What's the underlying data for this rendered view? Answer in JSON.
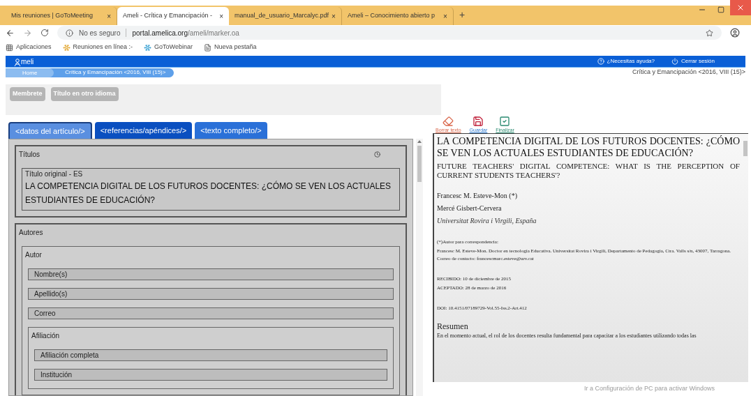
{
  "browser": {
    "tabs": [
      {
        "title": "Mis reuniones | GoToMeeting",
        "selected": false,
        "close": "×"
      },
      {
        "title": "Ameli - Crítica y Emancipación -",
        "selected": true,
        "close": "×"
      },
      {
        "title": "manual_de_usuario_Marcalyc.pdf",
        "selected": false,
        "close": "×"
      },
      {
        "title": "Ameli – Conocimiento abierto p",
        "selected": false,
        "close": "×"
      }
    ],
    "new_tab": "+",
    "security": "No es seguro",
    "url_host": "portal.amelica.org",
    "url_path": "/ameli/marker.oa",
    "bookmarks": [
      "Aplicaciones",
      "Reuniones en línea :-",
      "GoToWebinar",
      "Nueva pestaña"
    ]
  },
  "app": {
    "logo": "meli",
    "help": "¿Necesitas ayuda?",
    "logout": "Cerrar sesión",
    "breadcrumb": [
      "Home",
      "Crítica y Emancipación <2016, VIII (15)>"
    ],
    "issue": "Crítica y Emancipación <2016, VIII (15)>",
    "tool_buttons": [
      "Membrete",
      "Título en otro idioma"
    ],
    "tabs": [
      {
        "label": "<datos del artículo/>",
        "selected": true
      },
      {
        "label": "<referencias/apéndices/>",
        "selected": false
      },
      {
        "label": "<texto completo/>",
        "selected": false
      }
    ],
    "sections": [
      {
        "title": "Títulos",
        "children": [
          {
            "kind": "text",
            "label": "Título original - ES",
            "value": "LA COMPETENCIA DIGITAL DE LOS FUTUROS DOCENTES: ¿CÓMO SE VEN LOS ACTUALES ESTUDIANTES DE EDUCACIÓN?"
          }
        ]
      },
      {
        "title": "Autores",
        "children": [
          {
            "kind": "group",
            "title": "Autor",
            "children": [
              {
                "kind": "field",
                "label": "Nombre(s)"
              },
              {
                "kind": "field",
                "label": "Apellido(s)"
              },
              {
                "kind": "field",
                "label": "Correo"
              },
              {
                "kind": "group",
                "title": "Afiliación",
                "children": [
                  {
                    "kind": "field",
                    "label": "Afiliación completa"
                  },
                  {
                    "kind": "field",
                    "label": "Institución"
                  }
                ]
              }
            ]
          }
        ]
      }
    ],
    "doc_tools": [
      "Borrar texto",
      "Guardar",
      "Finalizar"
    ],
    "document": [
      {
        "kind": "title",
        "text": "LA COMPETENCIA DIGITAL DE LOS FUTUROS DOCENTES: ¿CÓMO SE VEN LOS ACTUALES ESTUDIANTES DE EDUCACIÓN?"
      },
      {
        "kind": "subtitle",
        "text": "FUTURE TEACHERS' DIGITAL COMPETENCE: WHAT IS THE PERCEPTION OF CURRENT STUDENTS TEACHERS'?"
      },
      {
        "kind": "gap"
      },
      {
        "kind": "line",
        "text": "Francesc M. Esteve-Mon (*)"
      },
      {
        "kind": "line",
        "text": "Mercé Gisbert-Cervera"
      },
      {
        "kind": "italic",
        "text": "Universitat Rovira i Virgili, España"
      },
      {
        "kind": "gap"
      },
      {
        "kind": "small",
        "text": "(*)Autor para correspondencia:"
      },
      {
        "kind": "small",
        "text": "Francesc M. Esteve-Mon. Doctor en tecnología Educativa. Universitat Rovira i Virgili, Departamento de Pedagogía, Ctra. Valls s/n, 43007, Tarragona. Correo de contacto: francescmarc.esteve@urv.cat"
      },
      {
        "kind": "gap"
      },
      {
        "kind": "small",
        "text": "RECIBIDO: 10 de diciembre de 2015"
      },
      {
        "kind": "small",
        "text": "ACEPTADO: 28 de marzo de 2016"
      },
      {
        "kind": "gap"
      },
      {
        "kind": "small",
        "text": "DOI: 10.4151/07189729-Vol.55-Iss.2-Art.412"
      },
      {
        "kind": "heading",
        "text": "Resumen"
      },
      {
        "kind": "body",
        "text": "En el momento actual, el rol de los docentes resulta fundamental para capacitar a los estudiantes utilizando todas las"
      }
    ]
  },
  "os_notice": "Ir a Configuración de PC para activar Windows"
}
